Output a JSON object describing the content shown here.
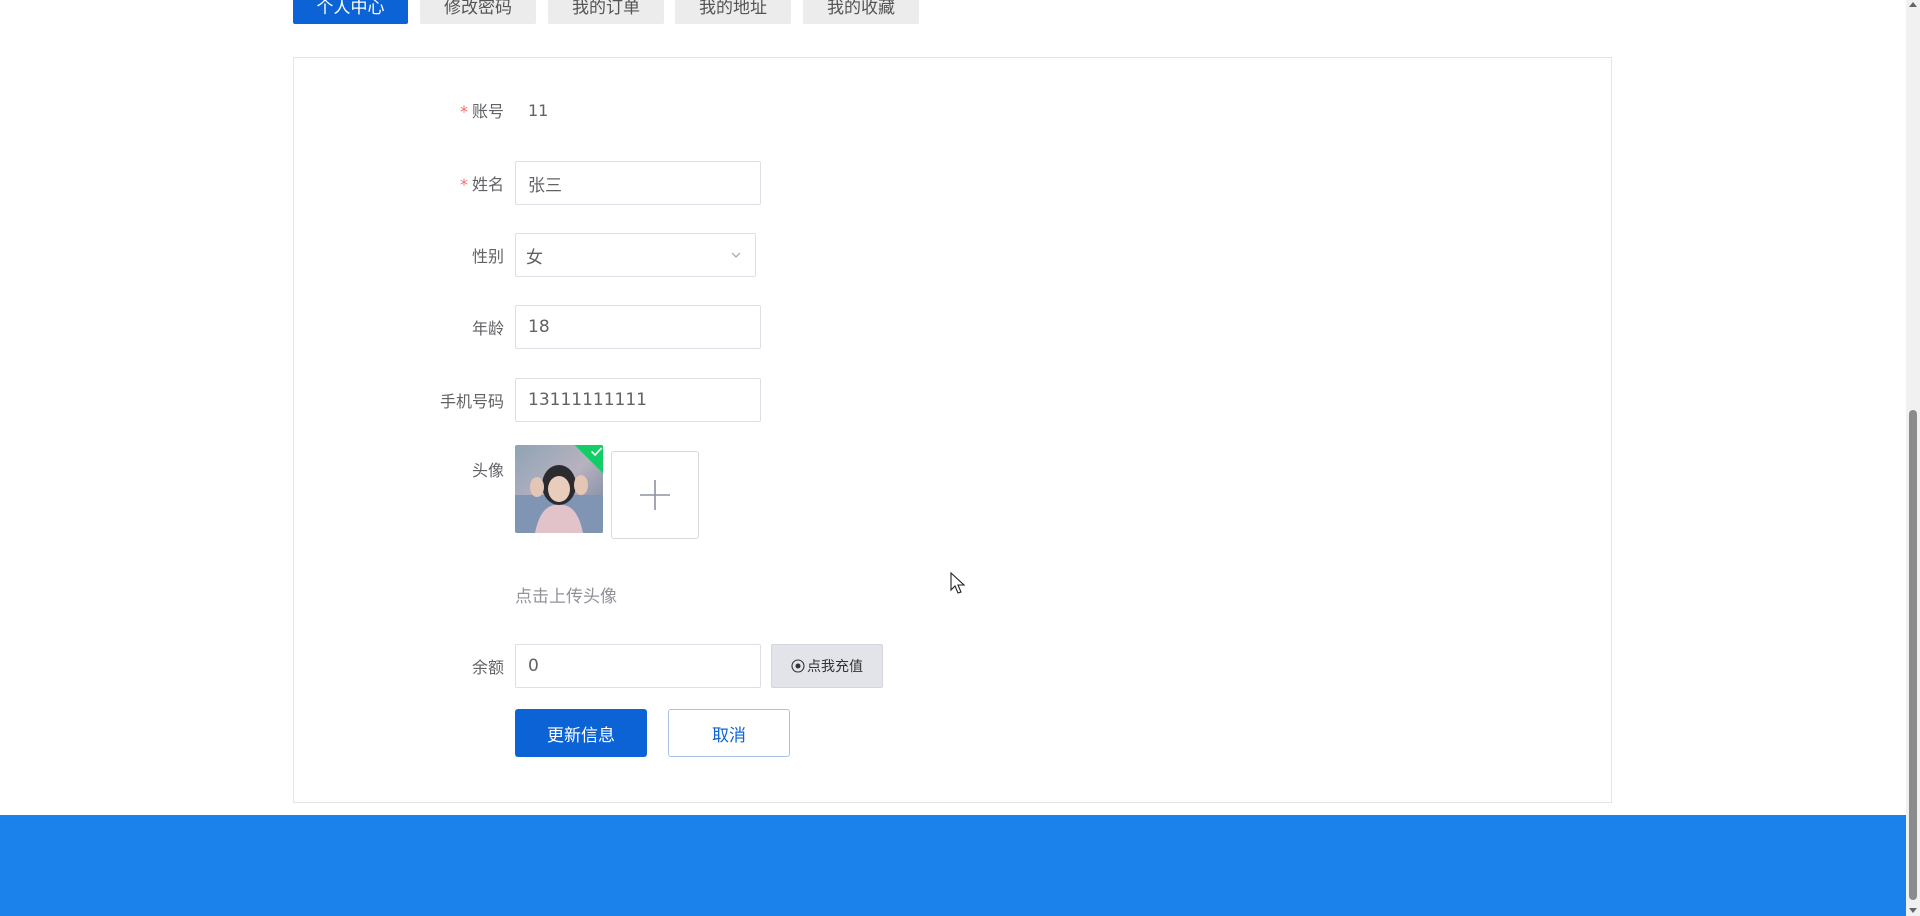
{
  "tabs": [
    {
      "label": "个人中心",
      "active": true
    },
    {
      "label": "修改密码",
      "active": false
    },
    {
      "label": "我的订单",
      "active": false
    },
    {
      "label": "我的地址",
      "active": false
    },
    {
      "label": "我的收藏",
      "active": false
    }
  ],
  "form": {
    "account": {
      "label": "账号",
      "value": "11"
    },
    "name": {
      "label": "姓名",
      "value": "张三"
    },
    "gender": {
      "label": "性别",
      "value": "女"
    },
    "age": {
      "label": "年龄",
      "value": "18"
    },
    "phone": {
      "label": "手机号码",
      "value": "13111111111"
    },
    "avatar": {
      "label": "头像",
      "hint": "点击上传头像"
    },
    "balance": {
      "label": "余额",
      "value": "0",
      "recharge_label": "点我充值"
    }
  },
  "actions": {
    "update_label": "更新信息",
    "cancel_label": "取消"
  },
  "colors": {
    "primary": "#0b63d6",
    "footer": "#1a82ea",
    "required": "#f56c6c",
    "success": "#13ce66"
  }
}
